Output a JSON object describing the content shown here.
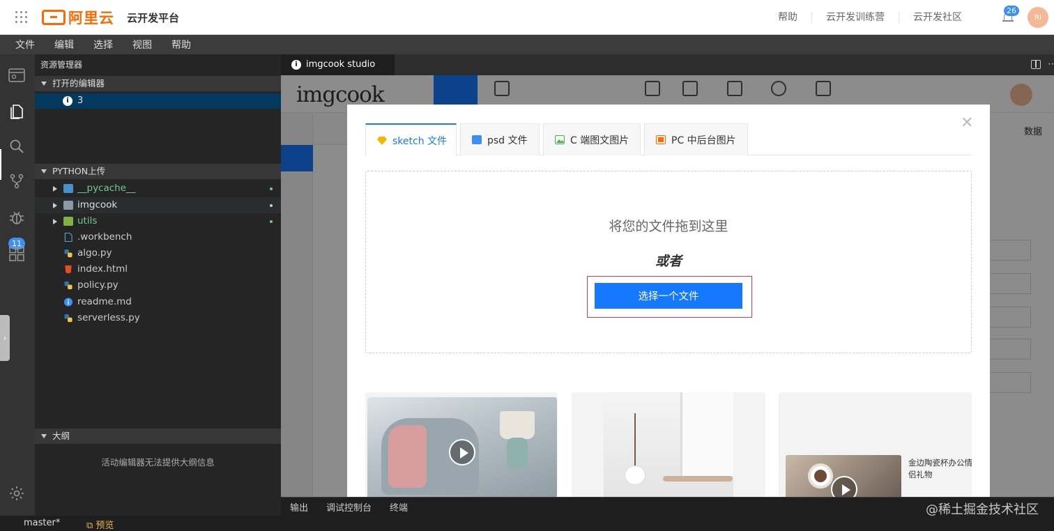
{
  "topbar": {
    "logo_text": "阿里云",
    "platform_title": "云开发平台",
    "nav": [
      "帮助",
      "云开发训练营",
      "云开发社区"
    ],
    "notification_count": "26",
    "avatar_initials": "RI",
    "brand_color": "#ff6a00"
  },
  "menubar": {
    "items": [
      "文件",
      "编辑",
      "选择",
      "视图",
      "帮助"
    ]
  },
  "activitybar": {
    "icons": [
      "webide-icon",
      "files-icon",
      "search-icon",
      "source-control-icon",
      "debug-icon",
      "extensions-icon",
      "settings-icon"
    ],
    "source_control_badge": "11"
  },
  "sidebar": {
    "title": "资源管理器",
    "open_editors_header": "打开的编辑器",
    "open_editor_label": "3",
    "project_header": "PYTHON上传",
    "files": [
      {
        "name": "__pycache__",
        "type": "folder",
        "color": "#73c991",
        "modified": true
      },
      {
        "name": "imgcook",
        "type": "folder",
        "color": "#dddddd",
        "modified": true
      },
      {
        "name": "utils",
        "type": "folder",
        "color": "#73c991",
        "modified": true
      },
      {
        "name": ".workbench",
        "type": "file",
        "icon": "file-icon",
        "color": "#cccccc"
      },
      {
        "name": "algo.py",
        "type": "file",
        "icon": "python-icon",
        "color": "#cccccc"
      },
      {
        "name": "index.html",
        "type": "file",
        "icon": "html-icon",
        "color": "#cccccc"
      },
      {
        "name": "policy.py",
        "type": "file",
        "icon": "python-icon",
        "color": "#cccccc"
      },
      {
        "name": "readme.md",
        "type": "file",
        "icon": "info-icon",
        "color": "#cccccc"
      },
      {
        "name": "serverless.py",
        "type": "file",
        "icon": "python-icon",
        "color": "#cccccc"
      }
    ],
    "outline_header": "大纲",
    "outline_empty": "活动编辑器无法提供大纲信息"
  },
  "editor": {
    "tab_label": "imgcook studio",
    "webview": {
      "logo": "imgcook",
      "right_label": "数据"
    }
  },
  "modal": {
    "tabs": [
      "sketch 文件",
      "psd 文件",
      "C 端图文图片",
      "PC 中后台图片"
    ],
    "active_tab": "sketch 文件",
    "drop_text": "将您的文件拖到这里",
    "or_text": "或者",
    "choose_button": "选择一个文件",
    "card3_title": "金边陶瓷杯办公情侣礼物",
    "accent_color": "#1677ff"
  },
  "panelbar": {
    "tabs": [
      "输出",
      "调试控制台",
      "终端"
    ]
  },
  "statusbar": {
    "branch": "master*",
    "preview": "预览"
  },
  "watermark": "@稀土掘金技术社区"
}
